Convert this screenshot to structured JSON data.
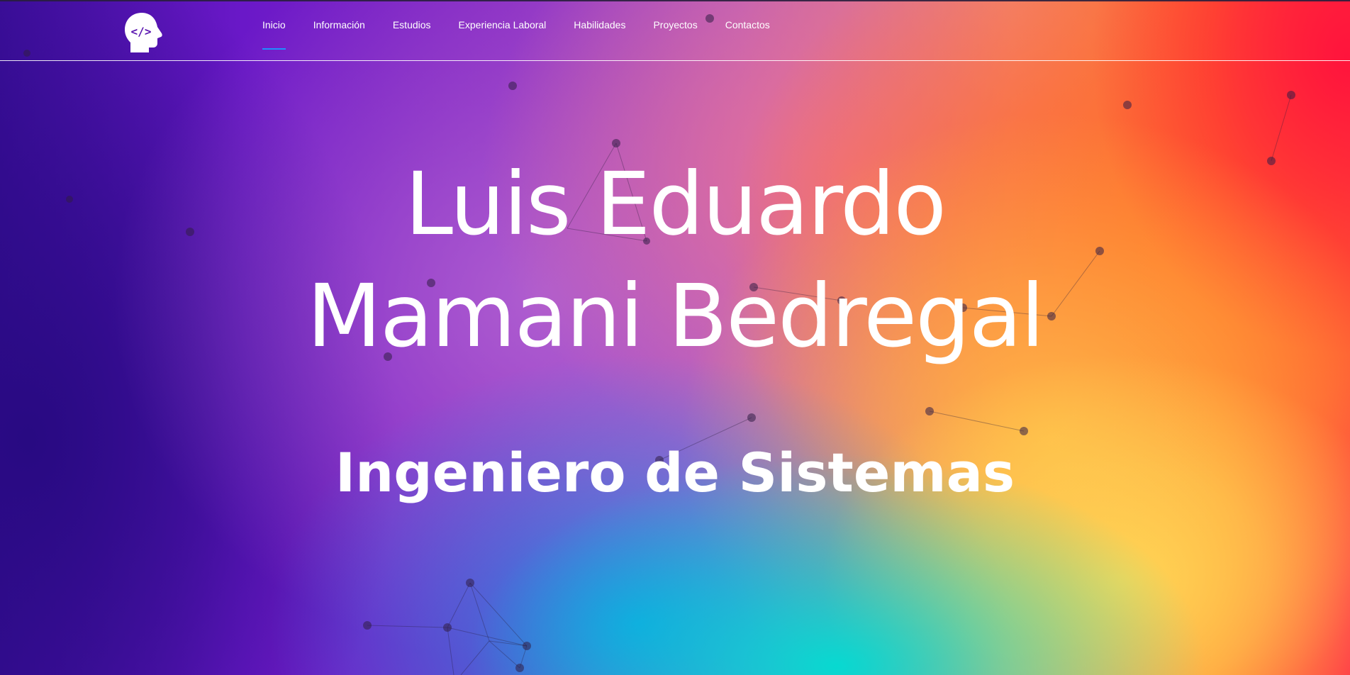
{
  "nav": {
    "logo_icon": "head-code-icon",
    "items": [
      {
        "label": "Inicio",
        "active": true
      },
      {
        "label": "Información",
        "active": false
      },
      {
        "label": "Estudios",
        "active": false
      },
      {
        "label": "Experiencia Laboral",
        "active": false
      },
      {
        "label": "Habilidades",
        "active": false
      },
      {
        "label": "Proyectos",
        "active": false
      },
      {
        "label": "Contactos",
        "active": false
      }
    ],
    "active_underline_color": "#1e90ff"
  },
  "hero": {
    "name_line1": "Luis Eduardo",
    "name_line2": "Mamani Bedregal",
    "role": "Ingeniero de Sistemas"
  },
  "colors": {
    "text": "#ffffff",
    "gradient_left": "#3c0e9a",
    "gradient_right": "#ff2a45",
    "accent_orange": "#ff6a2a",
    "accent_yellow": "#ffd654",
    "accent_cyan": "#00ded2"
  }
}
